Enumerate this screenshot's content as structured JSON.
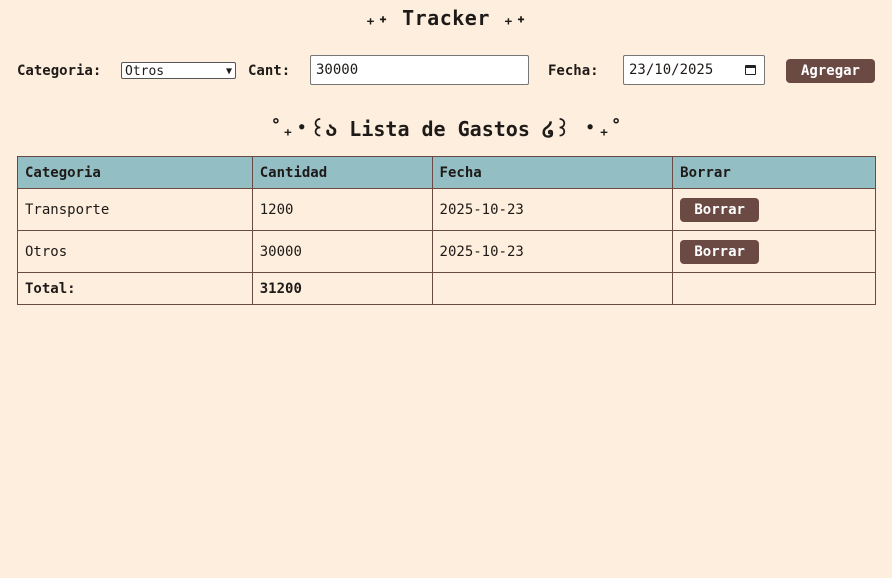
{
  "title": "₊˖ Tracker ₊˖",
  "form": {
    "categoria_label": "Categoria:",
    "categoria_value": "Otros",
    "cant_label": "Cant:",
    "cant_value": "30000",
    "fecha_label": "Fecha:",
    "fecha_value": "23/10/2025",
    "add_label": "Agregar"
  },
  "list_title": "˚₊‧꒰ა Lista de Gastos ໒꒱ ‧₊˚",
  "table": {
    "headers": [
      "Categoria",
      "Cantidad",
      "Fecha",
      "Borrar"
    ],
    "rows": [
      {
        "categoria": "Transporte",
        "cantidad": "1200",
        "fecha": "2025-10-23",
        "delete_label": "Borrar"
      },
      {
        "categoria": "Otros",
        "cantidad": "30000",
        "fecha": "2025-10-23",
        "delete_label": "Borrar"
      }
    ],
    "total_label": "Total:",
    "total_value": "31200"
  }
}
